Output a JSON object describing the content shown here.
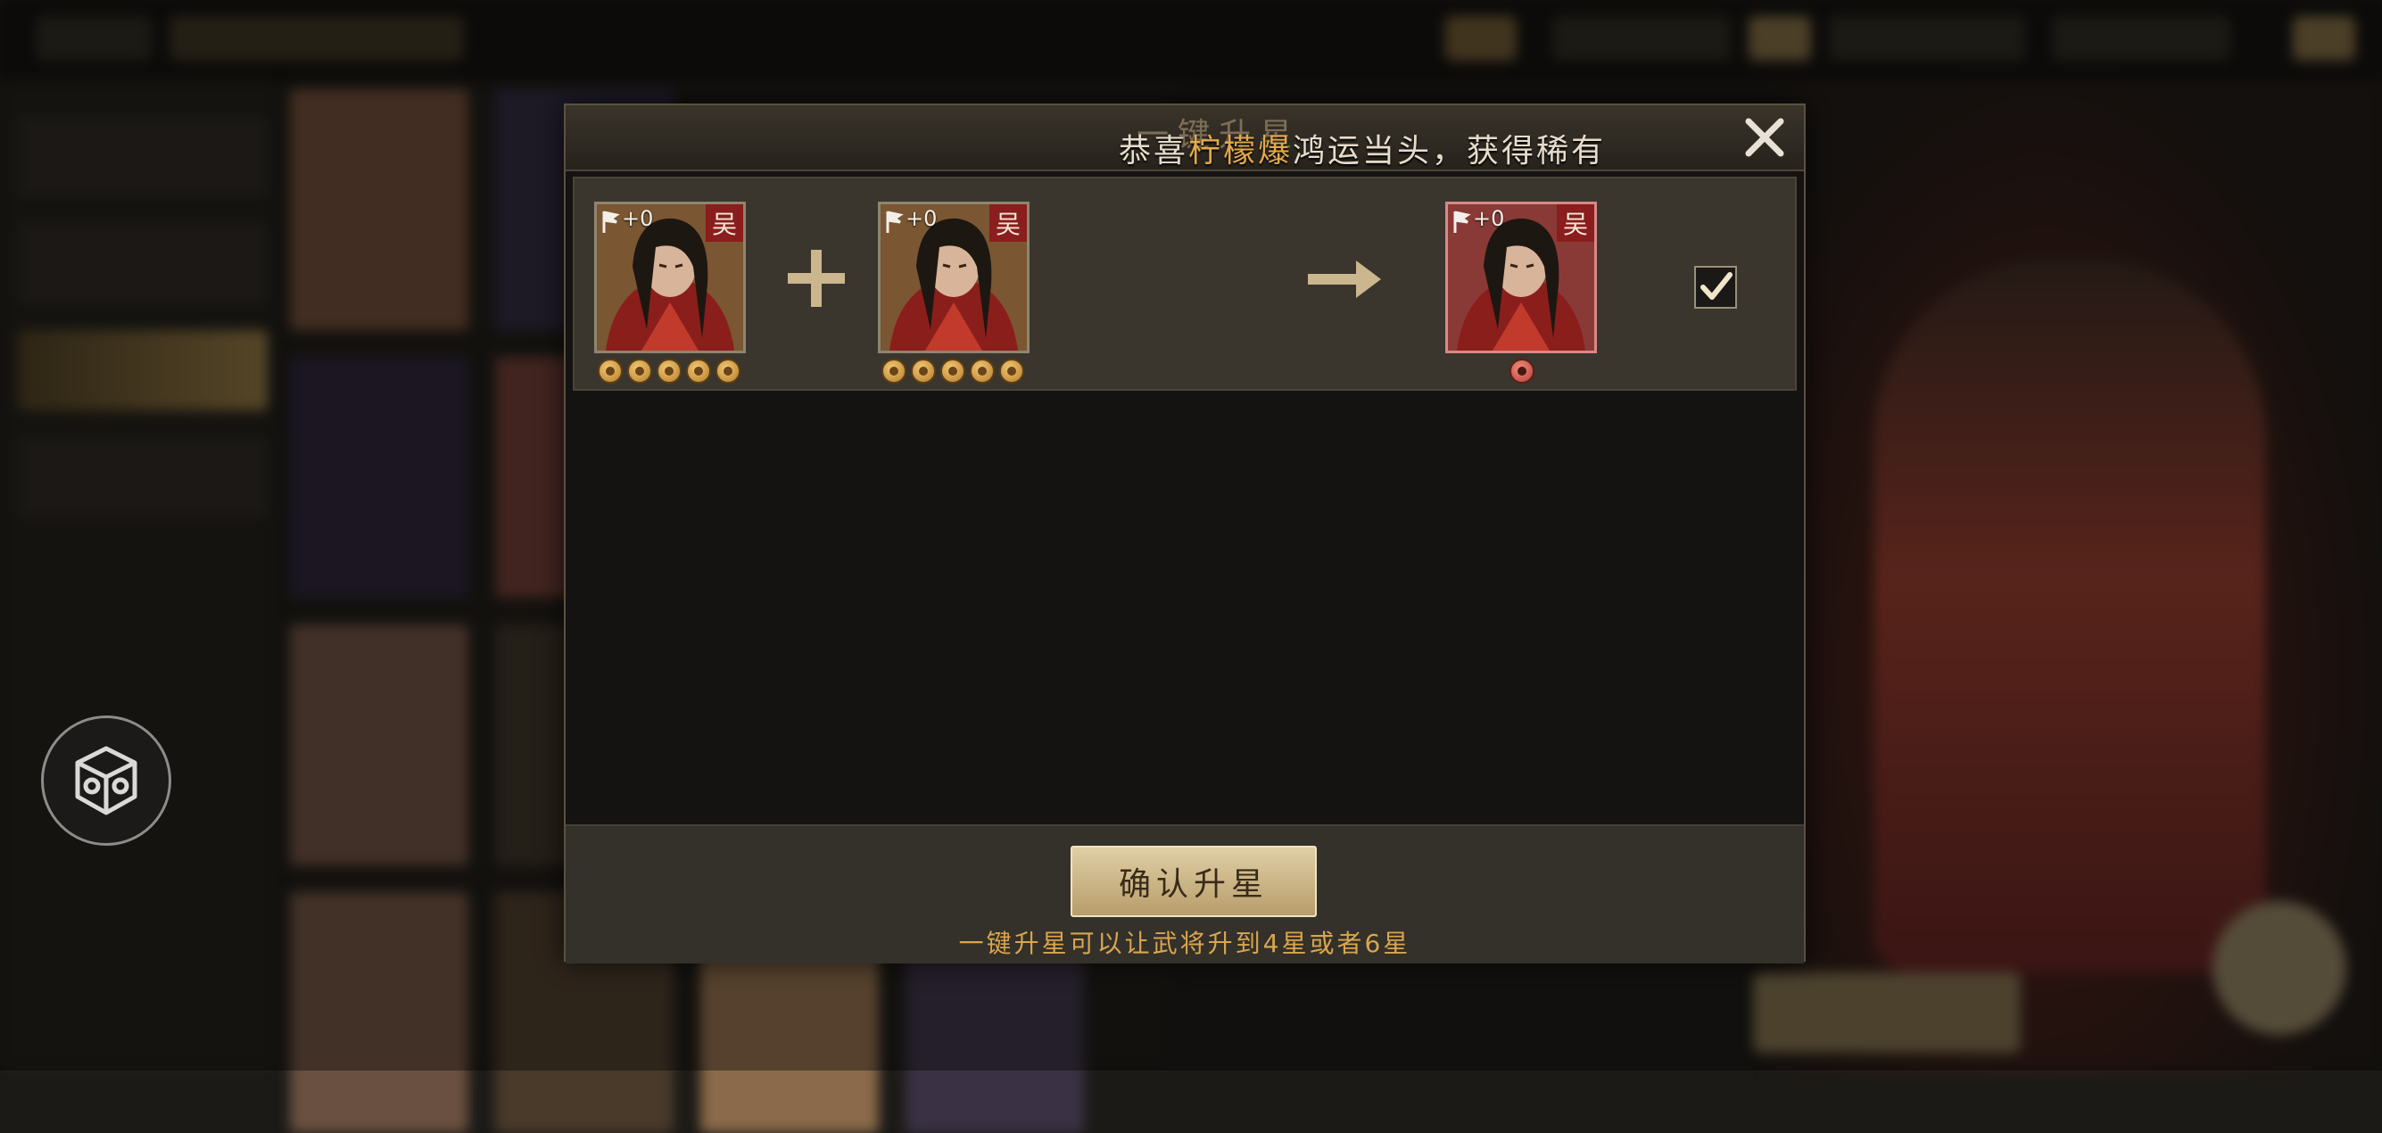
{
  "dialog": {
    "title": "一键升星",
    "marquee_prefix": "恭喜",
    "marquee_player": "柠檬爆",
    "marquee_suffix": "鸿运当头，获得稀有",
    "confirm_label": "确认升星",
    "hint": "一键升星可以让武将升到4星或者6星"
  },
  "upgrade_row": {
    "materials": [
      {
        "level": "+0",
        "faction": "吴",
        "stars": 5
      },
      {
        "level": "+0",
        "faction": "吴",
        "stars": 5
      }
    ],
    "result": {
      "level": "+0",
      "faction": "吴",
      "stars": 1
    },
    "selected": true
  },
  "colors": {
    "accent_gold": "#e4a94b",
    "faction_red": "#8a1d1d",
    "button_gold": "#d3bf92"
  },
  "icons": [
    "plus-icon",
    "arrow-right-icon",
    "check-icon",
    "close-icon",
    "level-flag-icon",
    "star-coin-icon",
    "menu-box-icon"
  ]
}
